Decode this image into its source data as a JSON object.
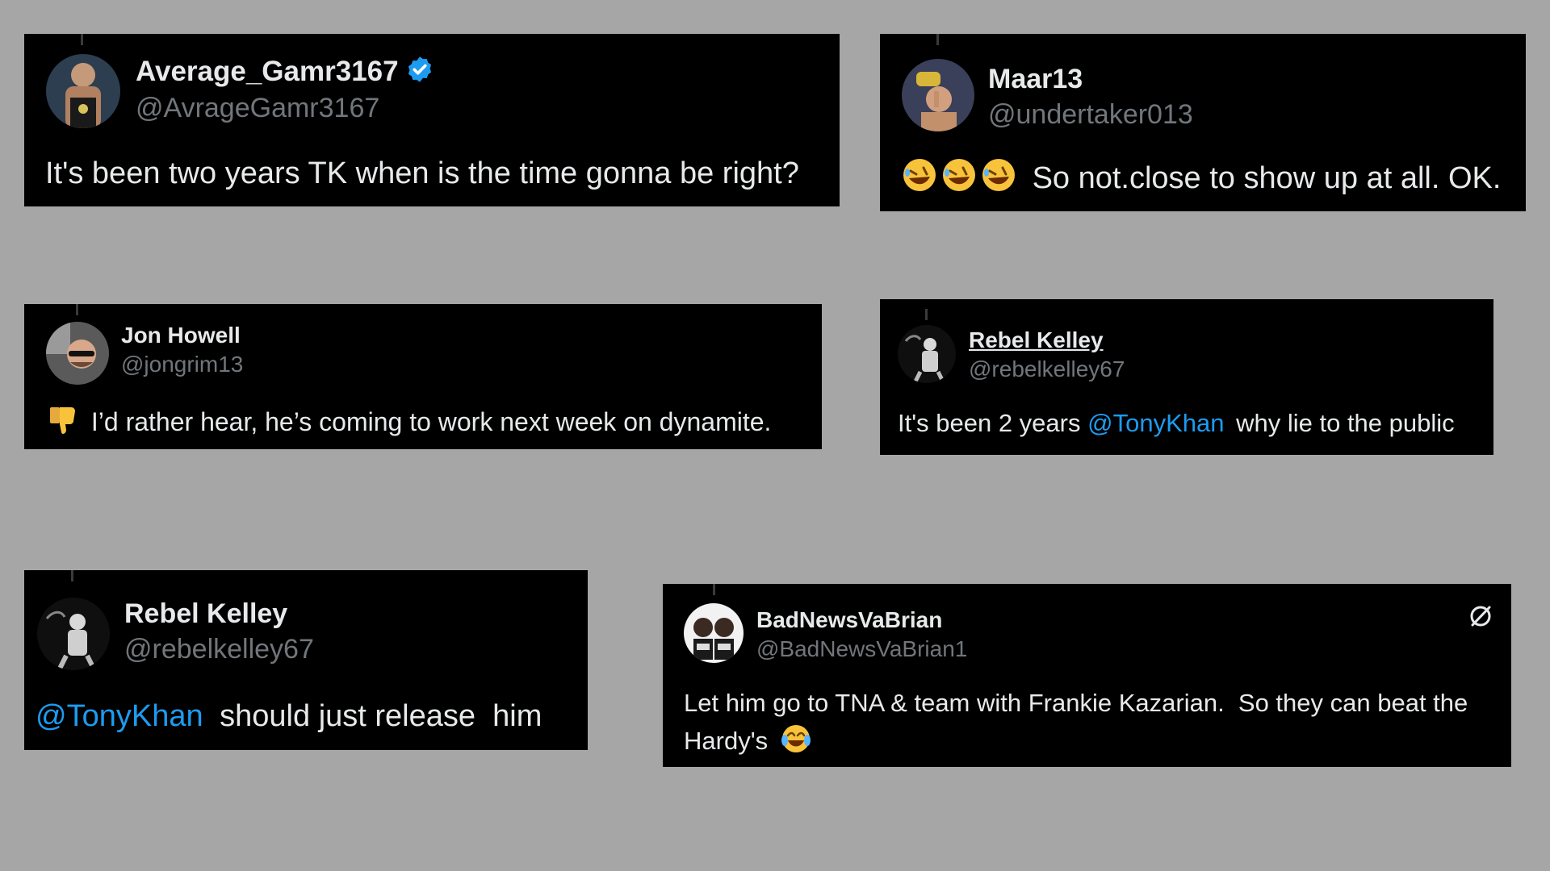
{
  "tweets": [
    {
      "name": "Average_Gamr3167",
      "handle": "@AvrageGamr3167",
      "verified": true,
      "text": "It's been two years TK when is the time gonna be right?"
    },
    {
      "name": "Maar13",
      "handle": "@undertaker013",
      "text": "So not.close to show up at all. OK.",
      "emoji": "rolling-on-floor-laughing"
    },
    {
      "name": "Jon Howell",
      "handle": "@jongrim13",
      "text": "I’d rather hear, he’s coming to work next week on dynamite.",
      "emoji": "thumbs-down"
    },
    {
      "name": "Rebel Kelley",
      "handle": "@rebelkelley67",
      "text_before": "It's been 2 years",
      "mention": "@TonyKhan",
      "text_after": "why lie to the public"
    },
    {
      "name": "Rebel Kelley",
      "handle": "@rebelkelley67",
      "mention": "@TonyKhan",
      "text_after": "should just release  him"
    },
    {
      "name": "BadNewsVaBrian",
      "handle": "@BadNewsVaBrian1",
      "text_line1": "Let him go to TNA & team with Frankie Kazarian.  So they can beat the",
      "text_line2": "Hardy's",
      "emoji": "face-with-tears-of-joy",
      "corner_icon": "no-symbol-icon"
    }
  ],
  "colors": {
    "background": "#a6a6a6",
    "card": "#000000",
    "text": "#e7e9ea",
    "handle": "#71767b",
    "mention": "#1d9bf0",
    "verified": "#1d9bf0"
  }
}
